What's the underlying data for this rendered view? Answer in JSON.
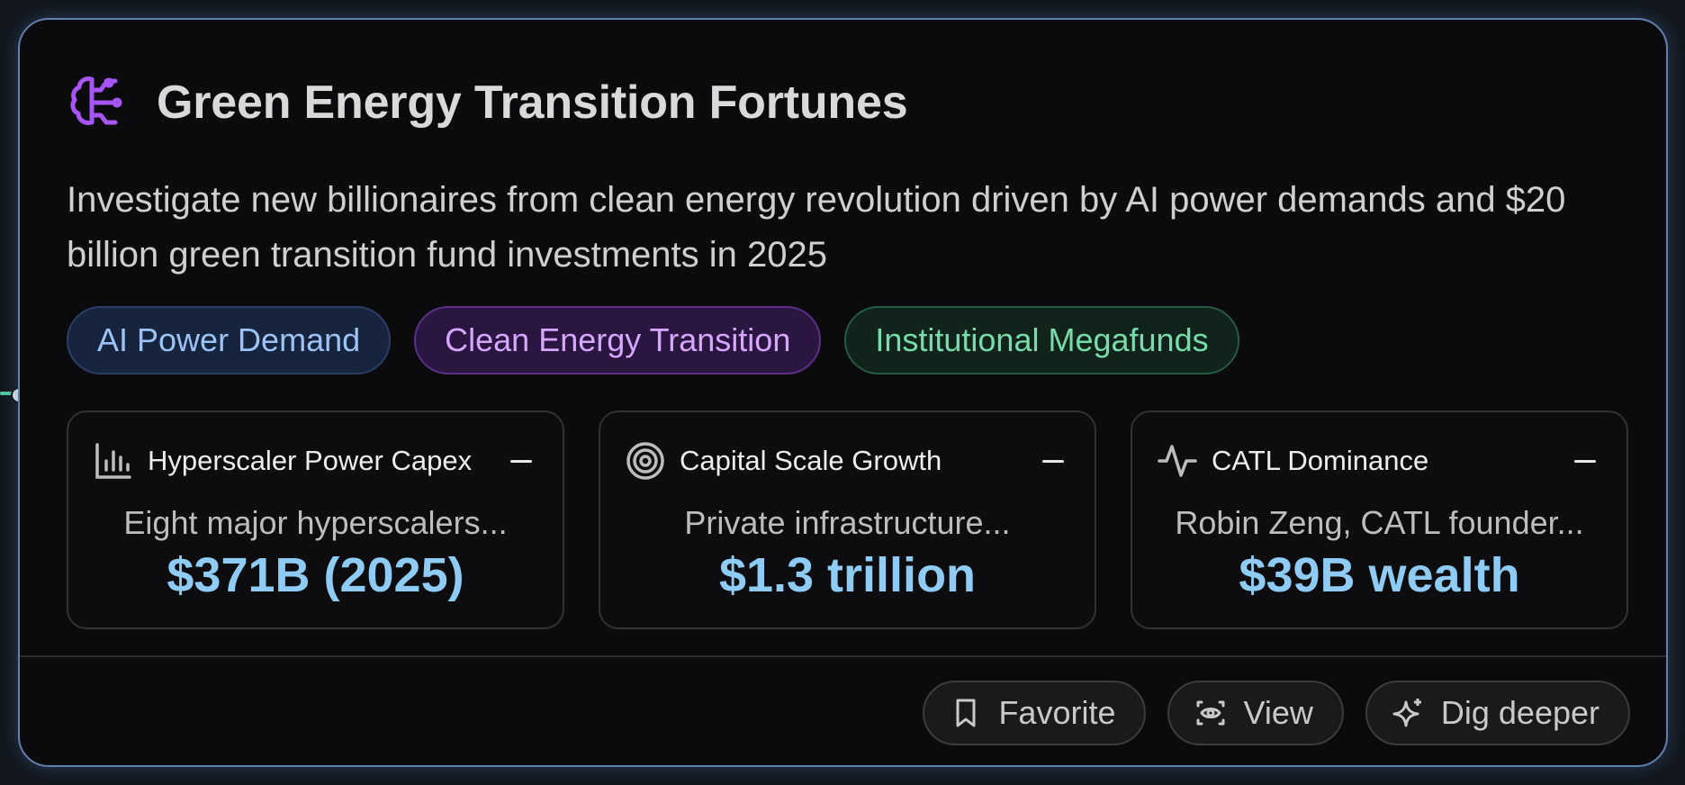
{
  "card": {
    "title": "Green Energy Transition Fortunes",
    "description": "Investigate new billionaires from clean energy revolution driven by AI power demands and $20 billion green transition fund investments in 2025",
    "icon": "brain-icon",
    "accent_color": "#a855f7"
  },
  "tags": [
    {
      "label": "AI Power Demand",
      "color": "#9cc3f5"
    },
    {
      "label": "Clean Energy Transition",
      "color": "#d7a6ff"
    },
    {
      "label": "Institutional Megafunds",
      "color": "#78dcaa"
    }
  ],
  "metrics": [
    {
      "name": "Hyperscaler Power Capex",
      "icon": "bar-chart-icon",
      "description": "Eight major hyperscalers...",
      "value": "$371B (2025)"
    },
    {
      "name": "Capital Scale Growth",
      "icon": "target-icon",
      "description": "Private infrastructure...",
      "value": "$1.3 trillion"
    },
    {
      "name": "CATL Dominance",
      "icon": "activity-icon",
      "description": "Robin Zeng, CATL founder...",
      "value": "$39B wealth"
    }
  ],
  "actions": [
    {
      "label": "Favorite",
      "icon": "bookmark-icon"
    },
    {
      "label": "View",
      "icon": "eye-icon"
    },
    {
      "label": "Dig deeper",
      "icon": "sparkle-icon"
    }
  ]
}
